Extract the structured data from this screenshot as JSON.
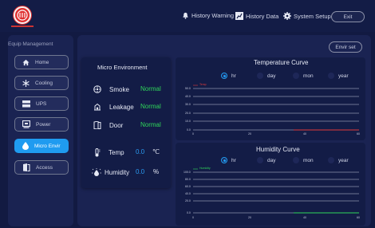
{
  "header": {
    "history_warning": "History Warning",
    "history_data": "History Data",
    "system_setup": "System Setup",
    "exit": "Exit"
  },
  "sidebar": {
    "title": "Equip Management",
    "items": [
      {
        "label": "Home",
        "icon": "home-icon"
      },
      {
        "label": "Cooling",
        "icon": "snowflake-icon"
      },
      {
        "label": "UPS",
        "icon": "ups-icon"
      },
      {
        "label": "Power",
        "icon": "power-icon"
      },
      {
        "label": "Micro Envir",
        "icon": "drop-icon",
        "active": true
      },
      {
        "label": "Access",
        "icon": "door-icon"
      }
    ]
  },
  "env_set": "Envir set",
  "micro_env": {
    "title": "Micro Environment",
    "smoke": {
      "label": "Smoke",
      "status": "Normal"
    },
    "leakage": {
      "label": "Leakage",
      "status": "Normal"
    },
    "door": {
      "label": "Door",
      "status": "Normal"
    },
    "temp": {
      "label": "Temp",
      "value": "0.0",
      "unit": "℃"
    },
    "humidity": {
      "label": "Humidity",
      "value": "0.0",
      "unit": "%"
    }
  },
  "ranges": [
    "hr",
    "day",
    "mon",
    "year"
  ],
  "temperature_chart": {
    "title": "Temperature Curve",
    "selected_range": "hr",
    "legend": "Temp",
    "y_ticks": [
      "50.0",
      "40.0",
      "30.0",
      "20.0",
      "10.0",
      "0.0"
    ],
    "x_ticks": [
      "0",
      "20",
      "40",
      "60"
    ]
  },
  "humidity_chart": {
    "title": "Humidity Curve",
    "selected_range": "hr",
    "legend": "Humidity",
    "y_ticks": [
      "100.0",
      "80.0",
      "60.0",
      "40.0",
      "20.0",
      "0.0"
    ],
    "x_ticks": [
      "0",
      "20",
      "40",
      "60"
    ]
  },
  "colors": {
    "accent": "#1f9bf0",
    "ok": "#2fd65a",
    "temp_line": "#e03a3a",
    "humidity_line": "#2fd65a",
    "logo": "#e03030"
  }
}
